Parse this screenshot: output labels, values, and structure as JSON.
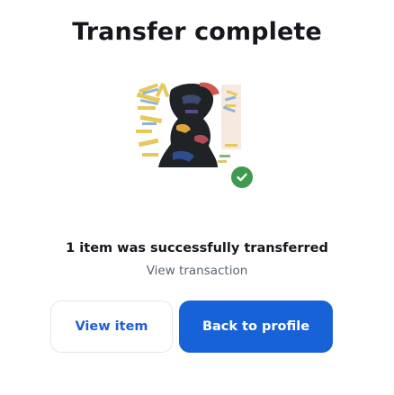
{
  "header": {
    "title": "Transfer complete"
  },
  "nft": {
    "status_icon": "check-circle-icon",
    "status_color": "#3d9a4f"
  },
  "result": {
    "message": "1 item was successfully transferred",
    "view_transaction_label": "View transaction"
  },
  "actions": {
    "view_item_label": "View item",
    "back_to_profile_label": "Back to profile"
  },
  "colors": {
    "primary": "#1762d7",
    "link_text": "#5b6470",
    "secondary_button_text": "#1e5fd6",
    "success": "#3d9a4f"
  }
}
